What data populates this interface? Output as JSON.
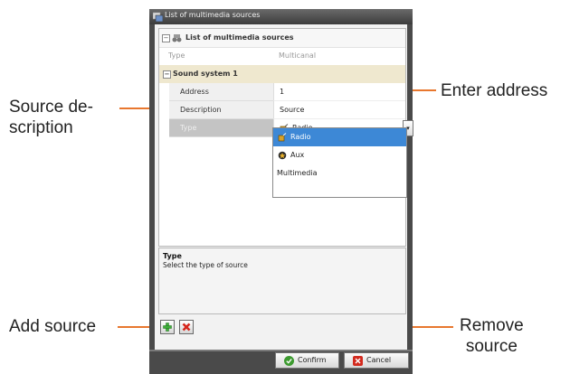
{
  "window": {
    "title": "List of multimedia sources"
  },
  "grid": {
    "header_title": "List of multimedia sources",
    "type_row": {
      "label": "Type",
      "value": "Multicanal"
    },
    "group": {
      "label": "Sound system 1",
      "expander_glyph": "−",
      "properties": [
        {
          "name": "Address",
          "value": "1"
        },
        {
          "name": "Description",
          "value": "Source"
        },
        {
          "name": "Type",
          "value": "Radio"
        }
      ]
    },
    "combo_arrow": "▾",
    "dropdown_options": [
      {
        "label": "Radio",
        "icon": "radio-icon",
        "selected": true
      },
      {
        "label": "Aux",
        "icon": "aux-icon",
        "selected": false
      },
      {
        "label": "Multimedia",
        "icon": "",
        "selected": false
      }
    ]
  },
  "description_panel": {
    "title": "Type",
    "text": "Select the type of source"
  },
  "toolbar": {
    "add_icon": "add-icon",
    "remove_icon": "remove-icon"
  },
  "footer": {
    "confirm_label": "Confirm",
    "cancel_label": "Cancel"
  },
  "callouts": {
    "source_description": "Source de-\nscription",
    "enter_address": "Enter address",
    "add_source": "Add source",
    "remove_source": "Remove\nsource"
  },
  "colors": {
    "callout_line": "#e8772e",
    "group_header_bg": "#efe8cf",
    "selected_item_bg": "#3d88d6",
    "window_frame": "#4a4a4a"
  }
}
